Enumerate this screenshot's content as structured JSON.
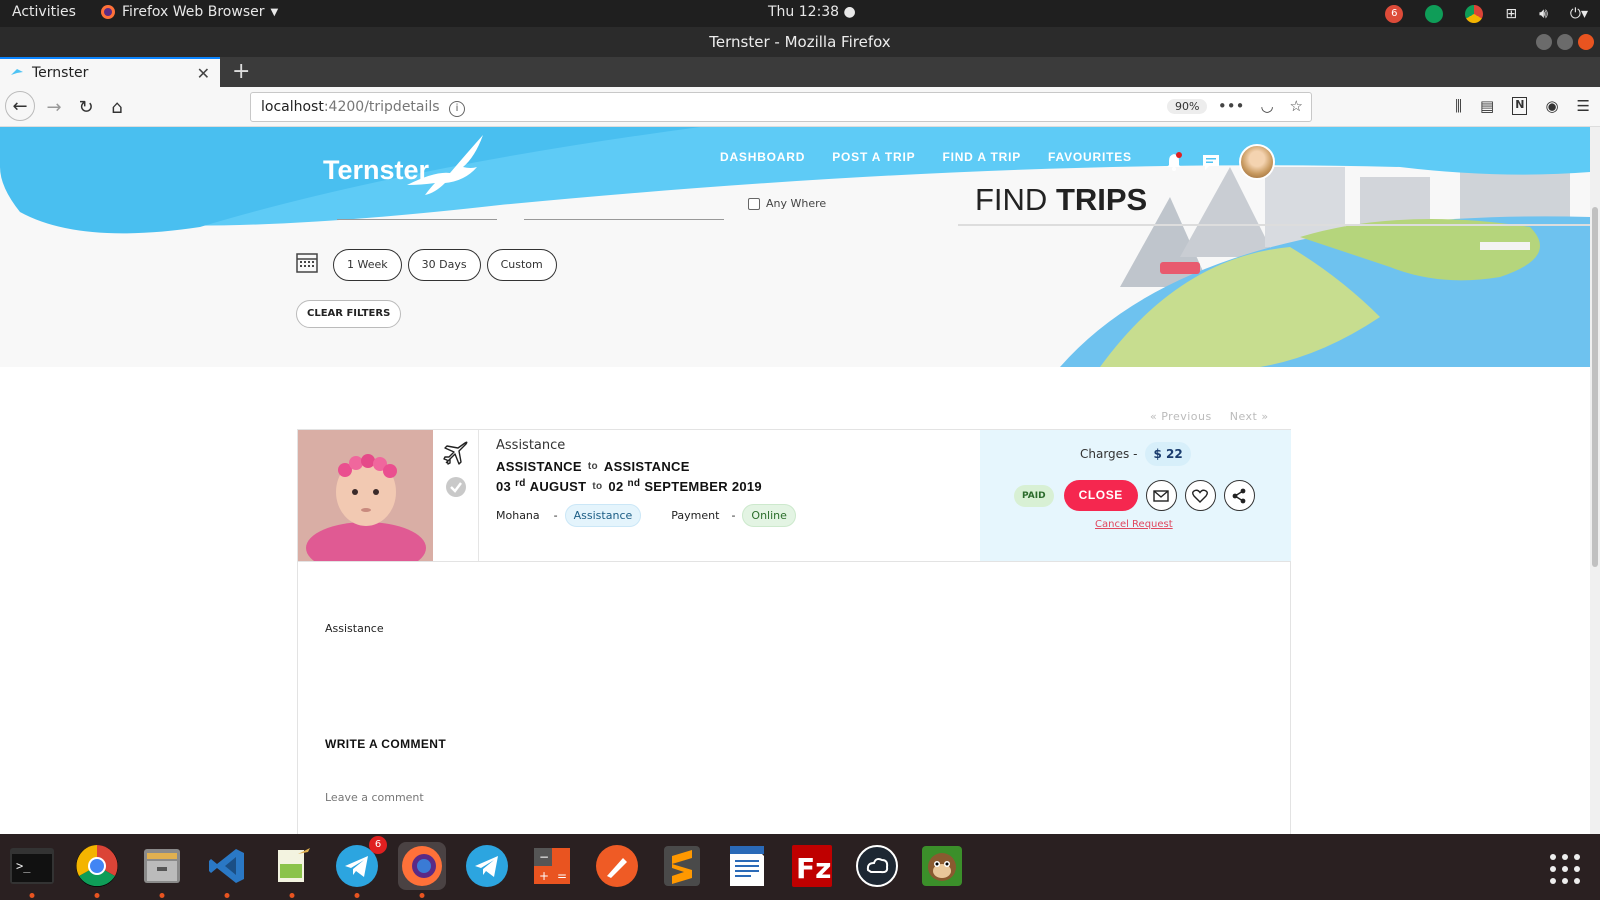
{
  "system": {
    "activities": "Activities",
    "app_menu": "Firefox Web Browser",
    "clock": "Thu 12:38",
    "tray_badge": "6"
  },
  "window": {
    "title": "Ternster - Mozilla Firefox"
  },
  "browser": {
    "tab_title": "Ternster",
    "url_host": "localhost",
    "url_rest": ":4200/tripdetails",
    "zoom": "90%"
  },
  "site": {
    "logo": "Ternster",
    "nav": [
      "DASHBOARD",
      "POST A TRIP",
      "FIND A TRIP",
      "FAVOURITES"
    ],
    "heading_light": "FIND ",
    "heading_bold": "TRIPS",
    "any_where": "Any Where",
    "ranges": [
      "1 Week",
      "30 Days",
      "Custom"
    ],
    "clear_filters": "CLEAR FILTERS",
    "pager_prev": "« Previous",
    "pager_next": "Next »"
  },
  "trip": {
    "type": "Assistance",
    "from": "ASSISTANCE",
    "to_word": "to",
    "to": "ASSISTANCE",
    "start_day": "03",
    "start_sup": "rd",
    "start_month": "AUGUST",
    "end_day": "02",
    "end_sup": "nd",
    "end_month_year": "SEPTEMBER 2019",
    "user": "Mohana",
    "dash": "-",
    "category": "Assistance",
    "payment_label": "Payment",
    "payment": "Online",
    "charges_label": "Charges -",
    "price": "$ 22",
    "paid": "PAID",
    "close": "CLOSE",
    "cancel": "Cancel Request",
    "description": "Assistance"
  },
  "comments": {
    "title": "WRITE A COMMENT",
    "placeholder": "Leave a comment"
  },
  "colors": {
    "brand_blue": "#4ec3f4",
    "accent_red": "#f5274f",
    "side_panel": "#e6f6fd"
  }
}
